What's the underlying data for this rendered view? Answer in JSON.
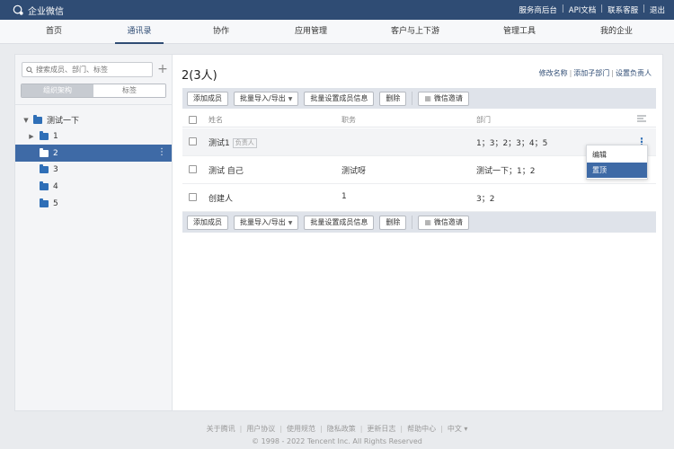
{
  "app": {
    "title": "企业微信"
  },
  "top_links": [
    "服务商后台",
    "API文档",
    "联系客服",
    "退出"
  ],
  "nav": {
    "items": [
      "首页",
      "通讯录",
      "协作",
      "应用管理",
      "客户与上下游",
      "管理工具",
      "我的企业"
    ],
    "active": "通讯录"
  },
  "sidebar": {
    "search_placeholder": "搜索成员、部门、标签",
    "tabs": [
      "组织架构",
      "标签"
    ],
    "tree": [
      {
        "label": "测试一下",
        "level": 0,
        "caret": "▼"
      },
      {
        "label": "1",
        "level": 1,
        "caret": "▶"
      },
      {
        "label": "2",
        "level": 1,
        "caret": "",
        "selected": true
      },
      {
        "label": "3",
        "level": 1,
        "caret": ""
      },
      {
        "label": "4",
        "level": 1,
        "caret": ""
      },
      {
        "label": "5",
        "level": 1,
        "caret": ""
      }
    ]
  },
  "department": {
    "title": "2(3人)",
    "actions": [
      "修改名称",
      "添加子部门",
      "设置负责人"
    ]
  },
  "toolbar": {
    "add_member": "添加成员",
    "batch_import_export": "批量导入/导出",
    "batch_set_info": "批量设置成员信息",
    "delete": "删除",
    "wechat_invite": "微信邀请"
  },
  "table": {
    "headers": [
      "姓名",
      "职务",
      "部门"
    ],
    "rows": [
      {
        "name": "测试1",
        "tag": "负责人",
        "position": "",
        "dept": "1；3；2；3；4；5"
      },
      {
        "name": "测试 自己",
        "tag": "",
        "position": "测试呀",
        "dept": "测试一下；1；2"
      },
      {
        "name": "创建人",
        "tag": "",
        "position": "1",
        "dept": "3；2"
      }
    ]
  },
  "context_menu": {
    "items": [
      "编辑",
      "置顶"
    ],
    "active": "置顶"
  },
  "footer": {
    "links": [
      "关于腾讯",
      "用户协议",
      "使用规范",
      "隐私政策",
      "更新日志",
      "帮助中心",
      "中文 ▾"
    ],
    "copyright": "© 1998 - 2022 Tencent Inc. All Rights Reserved"
  }
}
